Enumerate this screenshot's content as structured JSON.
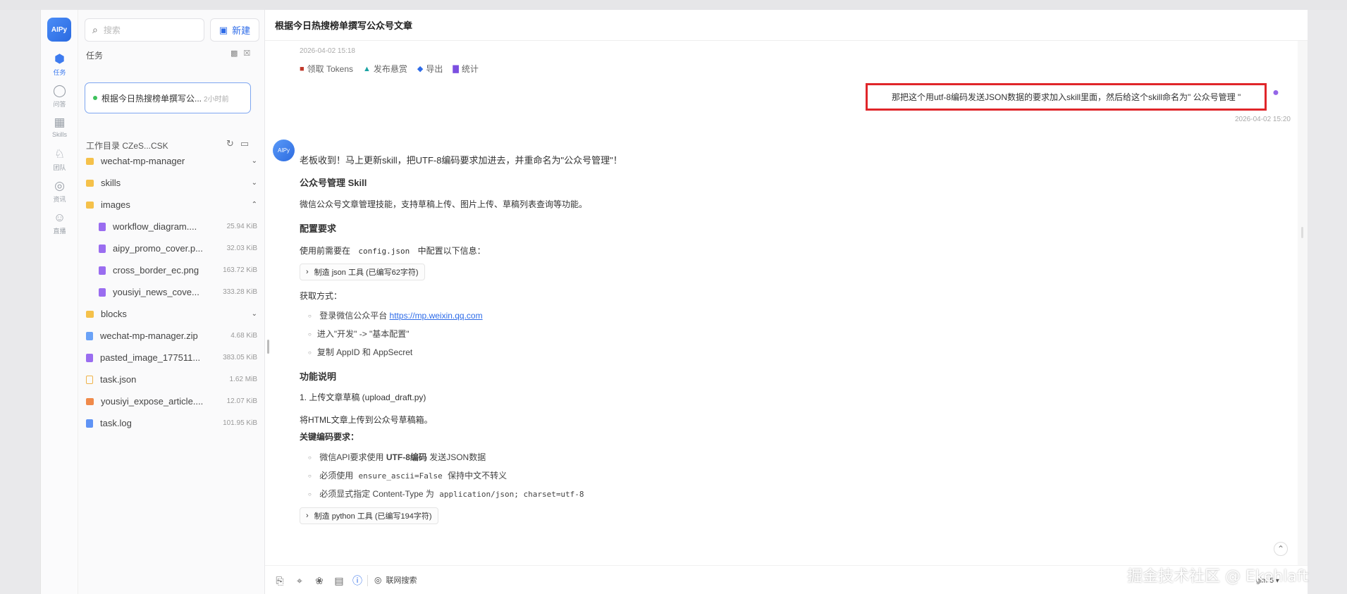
{
  "rail": {
    "logo": "AIPy",
    "items": [
      {
        "label": "任务",
        "icon": "cube-icon"
      },
      {
        "label": "问答",
        "icon": "chat-icon"
      },
      {
        "label": "Skills",
        "icon": "grid-icon"
      },
      {
        "label": "团队",
        "icon": "trophy-icon"
      },
      {
        "label": "资讯",
        "icon": "globe-icon"
      },
      {
        "label": "直播",
        "icon": "user-badge-icon"
      }
    ]
  },
  "panel": {
    "search_placeholder": "搜索",
    "new_label": "新建",
    "tasks_title": "任务",
    "task": {
      "title": "根据今日热搜榜单撰写公...",
      "time": "2小时前"
    },
    "workdir_title": "工作目录 CZeS...CSK",
    "files": [
      {
        "name": "wechat-mp-manager",
        "type": "folder",
        "size": "",
        "chevron": "⌄",
        "indent": 0
      },
      {
        "name": "skills",
        "type": "folder",
        "size": "",
        "chevron": "⌄",
        "indent": 0
      },
      {
        "name": "images",
        "type": "folder",
        "size": "",
        "chevron": "⌃",
        "indent": 0
      },
      {
        "name": "workflow_diagram....",
        "type": "img",
        "size": "25.94 KiB",
        "chevron": "",
        "indent": 1
      },
      {
        "name": "aipy_promo_cover.p...",
        "type": "img",
        "size": "32.03 KiB",
        "chevron": "",
        "indent": 1
      },
      {
        "name": "cross_border_ec.png",
        "type": "img",
        "size": "163.72 KiB",
        "chevron": "",
        "indent": 1
      },
      {
        "name": "yousiyi_news_cove...",
        "type": "img",
        "size": "333.28 KiB",
        "chevron": "",
        "indent": 1
      },
      {
        "name": "blocks",
        "type": "folder",
        "size": "",
        "chevron": "⌄",
        "indent": 0
      },
      {
        "name": "wechat-mp-manager.zip",
        "type": "zip",
        "size": "4.68 KiB",
        "chevron": "",
        "indent": 0
      },
      {
        "name": "pasted_image_177511...",
        "type": "img",
        "size": "383.05 KiB",
        "chevron": "",
        "indent": 0
      },
      {
        "name": "task.json",
        "type": "json",
        "size": "1.62 MiB",
        "chevron": "",
        "indent": 0
      },
      {
        "name": "yousiyi_expose_article....",
        "type": "md",
        "size": "12.07 KiB",
        "chevron": "",
        "indent": 0
      },
      {
        "name": "task.log",
        "type": "log",
        "size": "101.95 KiB",
        "chevron": "",
        "indent": 0
      }
    ]
  },
  "main": {
    "title": "根据今日热搜榜单撰写公众号文章",
    "prev_timestamp": "2026-04-02 15:18",
    "actions": [
      {
        "label": "领取 Tokens",
        "icon": "gift-icon",
        "color": "#c0392b"
      },
      {
        "label": "发布悬赏",
        "icon": "rocket-icon",
        "color": "#1aa3a3"
      },
      {
        "label": "导出",
        "icon": "export-icon",
        "color": "#2d6be8"
      },
      {
        "label": "统计",
        "icon": "bar-chart-icon",
        "color": "#7b4fe0"
      }
    ],
    "user_message": "那把这个用utf-8编码发送JSON数据的要求加入skill里面，然后给这个skill命名为\" 公众号管理 \"",
    "user_timestamp": "2026-04-02 15:20",
    "bot": {
      "intro": "老板收到！马上更新skill，把UTF-8编码要求加进去，并重命名为\"公众号管理\"！",
      "h_skill": "公众号管理 Skill",
      "desc": "微信公众号文章管理技能，支持草稿上传、图片上传、草稿列表查询等功能。",
      "h_config": "配置要求",
      "config_pre": "使用前需要在",
      "config_file": "config.json",
      "config_post": "中配置以下信息：",
      "tool1": "制造 json 工具  (已编写62字符)",
      "get_way": "获取方式：",
      "bullet1_pre": "登录微信公众平台",
      "bullet1_link": "https://mp.weixin.qq.com",
      "bullet2": "进入\"开发\" -> \"基本配置\"",
      "bullet3": "复制 AppID 和 AppSecret",
      "h_func": "功能说明",
      "func1": "1. 上传文章草稿 (upload_draft.py)",
      "func1_desc": "将HTML文章上传到公众号草稿箱。",
      "h_key": "关键编码要求：",
      "kb1_pre": "微信API要求使用",
      "kb1_bold": "UTF-8编码",
      "kb1_post": "发送JSON数据",
      "kb2_pre": "必须使用",
      "kb2_code": "ensure_ascii=False",
      "kb2_post": "保持中文不转义",
      "kb3_pre": "必须显式指定 Content-Type 为",
      "kb3_code": "application/json; charset=utf-8",
      "tool2": "制造 python 工具  (已编写194字符)"
    },
    "toolbar": {
      "web_search": "联网搜索",
      "model": "glm-5 ▾"
    }
  },
  "watermark": "掘金技术社区 @ Ekehlaft",
  "colors": {
    "accent": "#2d6be8",
    "highlight_border": "#e0262a"
  }
}
